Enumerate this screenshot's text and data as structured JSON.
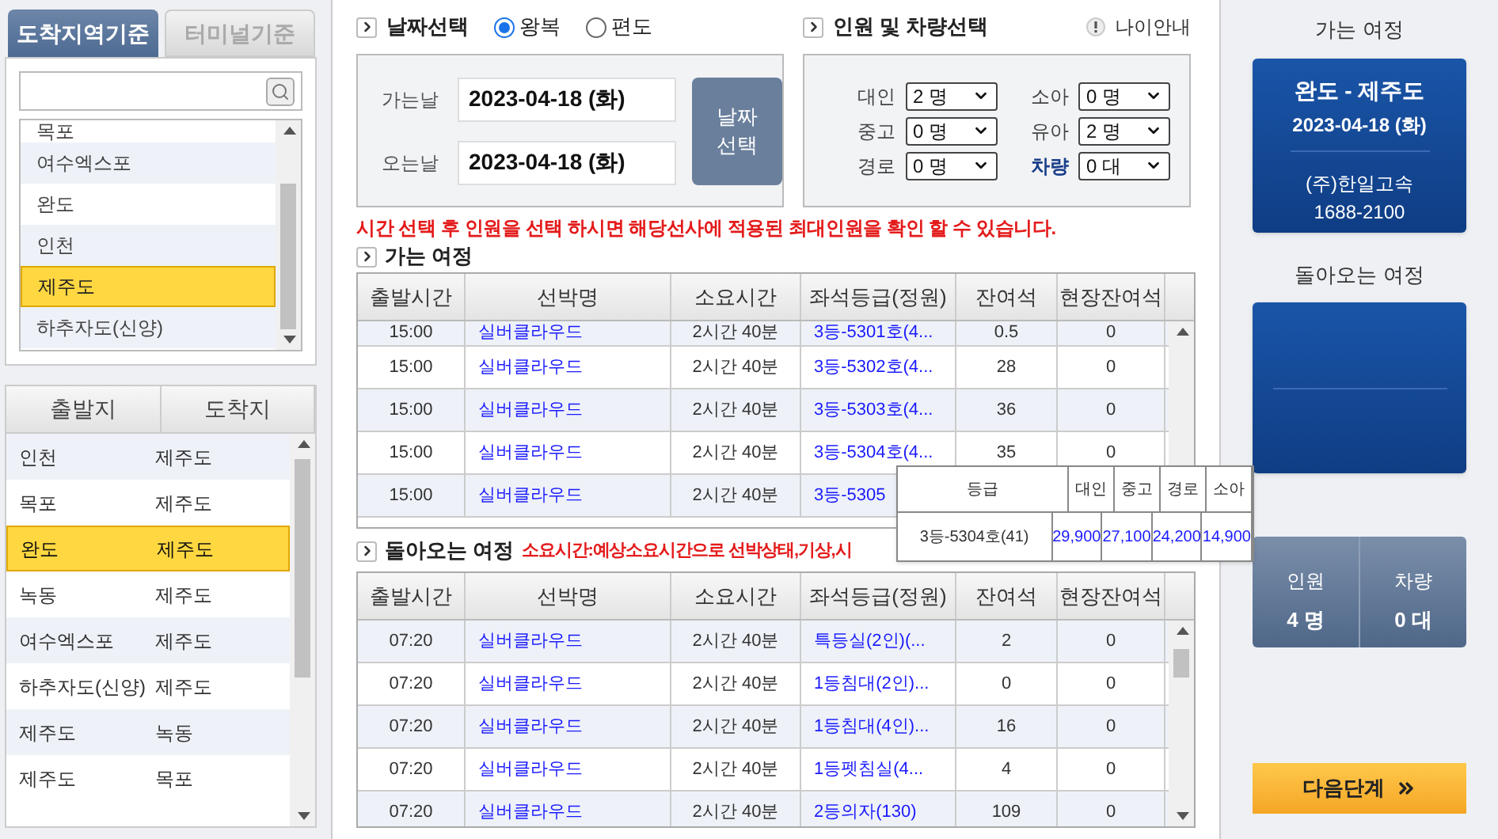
{
  "region_tabs": [
    {
      "label": "도착지역기준",
      "selected": true
    },
    {
      "label": "터미널기준",
      "selected": false
    }
  ],
  "regions": [
    {
      "name": "목포",
      "selected": false
    },
    {
      "name": "여수엑스포",
      "selected": false
    },
    {
      "name": "완도",
      "selected": false
    },
    {
      "name": "인천",
      "selected": false
    },
    {
      "name": "제주도",
      "selected": true
    },
    {
      "name": "하추자도(신양)",
      "selected": false
    }
  ],
  "route_columns": [
    "출발지",
    "도착지"
  ],
  "routes": [
    {
      "from": "인천",
      "to": "제주도",
      "selected": false
    },
    {
      "from": "목포",
      "to": "제주도",
      "selected": false
    },
    {
      "from": "완도",
      "to": "제주도",
      "selected": true
    },
    {
      "from": "녹동",
      "to": "제주도",
      "selected": false
    },
    {
      "from": "여수엑스포",
      "to": "제주도",
      "selected": false
    },
    {
      "from": "하추자도(신양)",
      "to": "제주도",
      "selected": false
    },
    {
      "from": "제주도",
      "to": "녹동",
      "selected": false
    },
    {
      "from": "제주도",
      "to": "목포",
      "selected": false
    }
  ],
  "date_section": {
    "title": "날짜선택",
    "trip_types": [
      {
        "label": "왕복",
        "selected": true
      },
      {
        "label": "편도",
        "selected": false
      }
    ],
    "depart_label": "가는날",
    "depart_date": "2023-04-18 (화)",
    "return_label": "오는날",
    "return_date": "2023-04-18 (화)",
    "button": "날짜 선택"
  },
  "passengers": {
    "title": "인원 및 차량선택",
    "age_info": "나이안내",
    "fields": [
      {
        "label": "대인",
        "value": "2 명",
        "kind": "person"
      },
      {
        "label": "소아",
        "value": "0 명",
        "kind": "person"
      },
      {
        "label": "중고",
        "value": "0 명",
        "kind": "person"
      },
      {
        "label": "유아",
        "value": "2 명",
        "kind": "person"
      },
      {
        "label": "경로",
        "value": "0 명",
        "kind": "person"
      },
      {
        "label": "차량",
        "value": "0 대",
        "kind": "vehicle"
      }
    ]
  },
  "notice": "시간 선택 후 인원을 선택 하시면 해당선사에 적용된 최대인원을 확인 할 수 있습니다.",
  "outbound": {
    "title": "가는 여정",
    "columns": [
      "출발시간",
      "선박명",
      "소요시간",
      "좌석등급(정원)",
      "잔여석",
      "현장잔여석"
    ],
    "rows": [
      [
        "15:00",
        "실버클라우드",
        "2시간 40분",
        "3등-5301호(4...",
        "0.5",
        "0"
      ],
      [
        "15:00",
        "실버클라우드",
        "2시간 40분",
        "3등-5302호(4...",
        "28",
        "0"
      ],
      [
        "15:00",
        "실버클라우드",
        "2시간 40분",
        "3등-5303호(4...",
        "36",
        "0"
      ],
      [
        "15:00",
        "실버클라우드",
        "2시간 40분",
        "3등-5304호(4...",
        "35",
        "0"
      ],
      [
        "15:00",
        "실버클라우드",
        "2시간 40분",
        "3등-5305",
        "",
        ""
      ]
    ]
  },
  "inbound": {
    "title": "돌아오는 여정",
    "note": "소요시간:예상소요시간으로 선박상태,기상,시",
    "columns": [
      "출발시간",
      "선박명",
      "소요시간",
      "좌석등급(정원)",
      "잔여석",
      "현장잔여석"
    ],
    "rows": [
      [
        "07:20",
        "실버클라우드",
        "2시간 40분",
        "특등실(2인)(...",
        "2",
        "0"
      ],
      [
        "07:20",
        "실버클라우드",
        "2시간 40분",
        "1등침대(2인)...",
        "0",
        "0"
      ],
      [
        "07:20",
        "실버클라우드",
        "2시간 40분",
        "1등침대(4인)...",
        "16",
        "0"
      ],
      [
        "07:20",
        "실버클라우드",
        "2시간 40분",
        "1등펫침실(4...",
        "4",
        "0"
      ],
      [
        "07:20",
        "실버클라우드",
        "2시간 40분",
        "2등의자(130)",
        "109",
        "0"
      ]
    ]
  },
  "fare_popup": {
    "columns": [
      "등급",
      "대인",
      "중고",
      "경로",
      "소아"
    ],
    "row": [
      "3등-5304호(41)",
      "29,900",
      "27,100",
      "24,200",
      "14,900"
    ]
  },
  "summary": {
    "outbound_title": "가는 여정",
    "outbound_card": {
      "route": "완도 - 제주도",
      "date": "2023-04-18 (화)",
      "company": "(주)한일고속",
      "phone": "1688-2100"
    },
    "inbound_title": "돌아오는 여정",
    "counts": [
      {
        "label": "인원",
        "value": "4 명"
      },
      {
        "label": "차량",
        "value": "0 대"
      }
    ],
    "next_button": "다음단계"
  }
}
